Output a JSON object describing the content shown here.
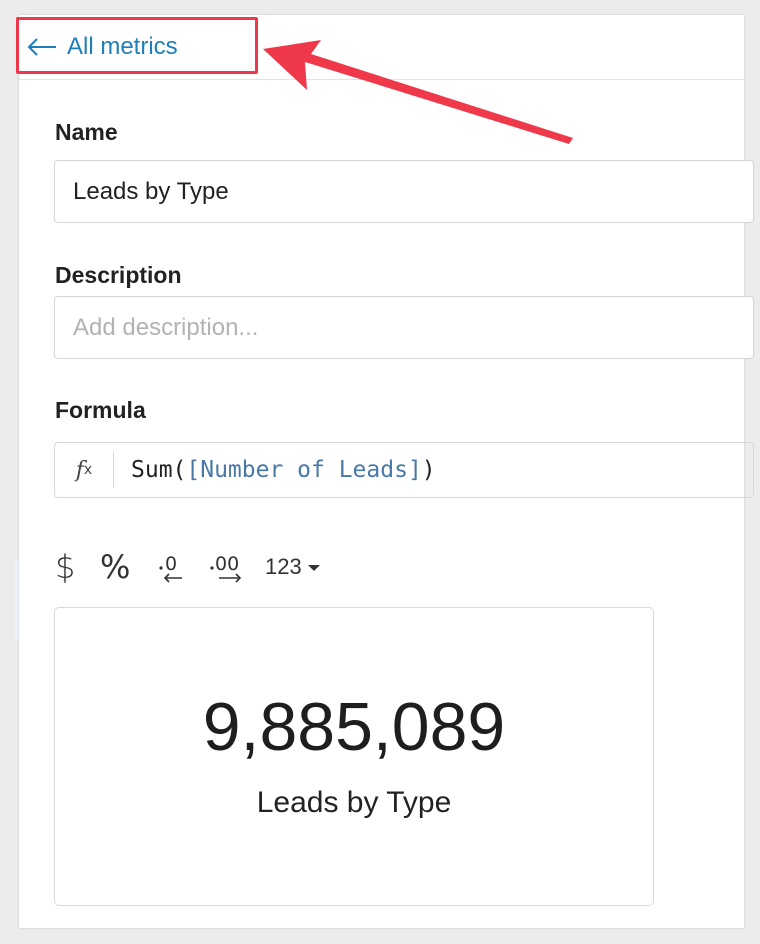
{
  "nav": {
    "back_label": "All metrics"
  },
  "form": {
    "name_label": "Name",
    "name_value": "Leads by Type",
    "description_label": "Description",
    "description_placeholder": "Add description...",
    "formula_label": "Formula",
    "formula_icon": "fx-icon",
    "formula_fn": "Sum(",
    "formula_ref": "[Number of Leads]",
    "formula_close": ")"
  },
  "format_toolbar": {
    "currency_label": "$",
    "percent_label": "%",
    "number_format_label": "123"
  },
  "preview": {
    "value": "9,885,089",
    "label": "Leads by Type"
  },
  "colors": {
    "link": "#1d7fb8",
    "annotation": "#f0384b",
    "formula_ref": "#4a78a6"
  }
}
